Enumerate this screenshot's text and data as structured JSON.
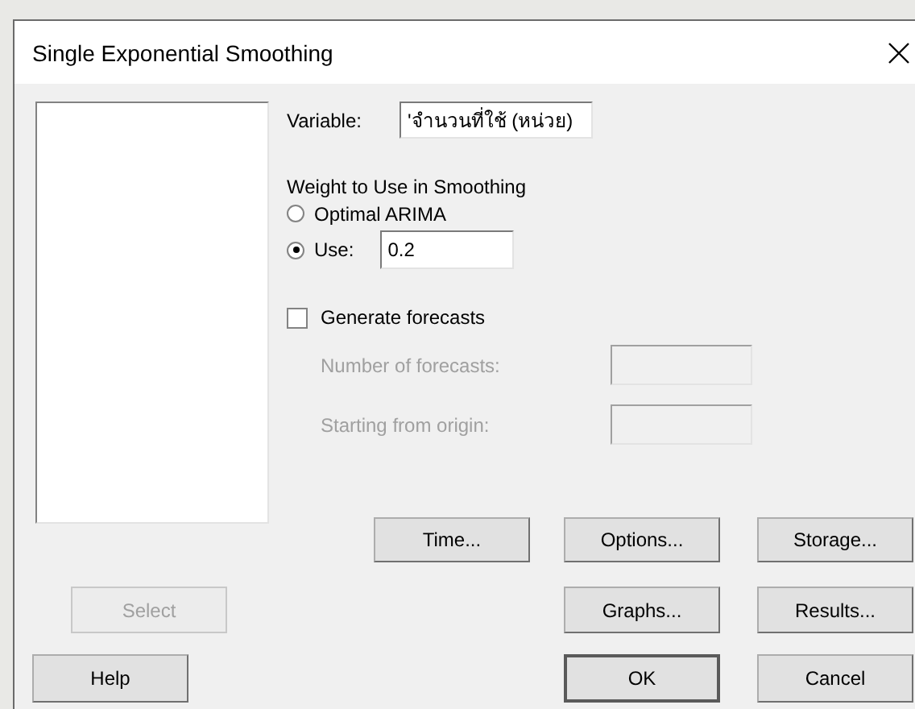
{
  "window": {
    "title": "Single Exponential Smoothing"
  },
  "variable": {
    "label": "Variable:",
    "value": "'จำนวนที่ใช้ (หน่วย)"
  },
  "weight": {
    "label": "Weight to Use in Smoothing",
    "options": [
      {
        "label": "Optimal ARIMA",
        "selected": false
      },
      {
        "label": "Use:",
        "selected": true,
        "value": "0.2"
      }
    ]
  },
  "forecasts": {
    "label": "Generate forecasts",
    "checked": false,
    "fields": [
      {
        "label": "Number of forecasts:",
        "disabled": true
      },
      {
        "label": "Starting from origin:",
        "disabled": true
      }
    ]
  },
  "buttons": [
    {
      "label": "Time...",
      "disabled": false,
      "default": false
    },
    {
      "label": "Options...",
      "disabled": false,
      "default": false
    },
    {
      "label": "Storage...",
      "disabled": false,
      "default": false
    },
    {
      "label": "Select",
      "disabled": true,
      "default": false
    },
    {
      "label": "Graphs...",
      "disabled": false,
      "default": false
    },
    {
      "label": "Results...",
      "disabled": false,
      "default": false
    },
    {
      "label": "Help",
      "disabled": false,
      "default": false
    },
    {
      "label": "OK",
      "disabled": false,
      "default": true
    },
    {
      "label": "Cancel",
      "disabled": false,
      "default": false
    }
  ]
}
